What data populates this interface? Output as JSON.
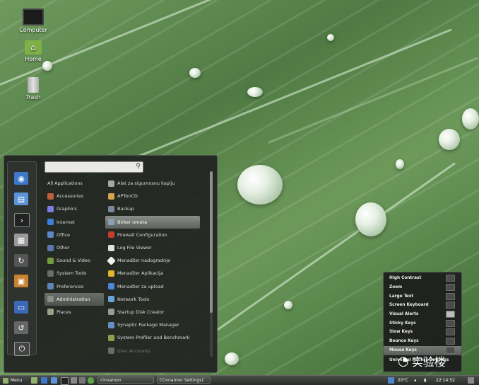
{
  "desktop": {
    "icons": [
      {
        "label": "Computer",
        "icon": "computer-icon"
      },
      {
        "label": "Home",
        "icon": "home-folder-icon"
      },
      {
        "label": "Trash",
        "icon": "trash-icon"
      }
    ]
  },
  "menu": {
    "search": {
      "placeholder": "",
      "value": ""
    },
    "favorites": [
      "browser-icon",
      "document-icon",
      "terminal-icon",
      "settings-icon",
      "software-manager-icon",
      "package-icon",
      "display-icon",
      "logout-icon",
      "power-icon"
    ],
    "categories": [
      {
        "label": "All Applications",
        "color": "#00000000"
      },
      {
        "label": "Accessories",
        "color": "#c25d3b"
      },
      {
        "label": "Graphics",
        "color": "#7c7ee0"
      },
      {
        "label": "Internet",
        "color": "#3c7fd6"
      },
      {
        "label": "Office",
        "color": "#5f86c6"
      },
      {
        "label": "Other",
        "color": "#5b79b0"
      },
      {
        "label": "Sound & Video",
        "color": "#6f9e3a"
      },
      {
        "label": "System Tools",
        "color": "#6c6c6c"
      },
      {
        "label": "Preferences",
        "color": "#5c86b8"
      },
      {
        "label": "Administration",
        "color": "#8a8f8a"
      },
      {
        "label": "Places",
        "color": "#9aa08e"
      }
    ],
    "selected_category": "Administration",
    "apps": [
      {
        "label": "Alat za sigurnosnu kopiju",
        "color": "#a8a8a0"
      },
      {
        "label": "APTonCD",
        "color": "#d3a64a"
      },
      {
        "label": "Backup",
        "color": "#7a8a9a"
      },
      {
        "label": "Birker ometa",
        "color": "#8ea0b4"
      },
      {
        "label": "Firewall Configuration",
        "color": "#c23d2b"
      },
      {
        "label": "Log File Viewer",
        "color": "#e0e0e0"
      },
      {
        "label": "Menadžer nadogradnje",
        "color": "#f2f2f2"
      },
      {
        "label": "Menadžer Aplikacija",
        "color": "#e3b52b"
      },
      {
        "label": "Menadžer za upload",
        "color": "#4c88d8"
      },
      {
        "label": "Network Tools",
        "color": "#6aa2d8"
      },
      {
        "label": "Startup Disk Creator",
        "color": "#9a9a9a"
      },
      {
        "label": "Synaptic Package Manager",
        "color": "#6a8fc6"
      },
      {
        "label": "System Profiler and Benchmark",
        "color": "#8aa050"
      },
      {
        "label": "User Accounts",
        "color": "#6a6a6a"
      }
    ],
    "selected_app": "Birker ometa"
  },
  "a11y": {
    "items": [
      {
        "label": "High Contrast",
        "on": false
      },
      {
        "label": "Zoom",
        "on": false
      },
      {
        "label": "Large Text",
        "on": false
      },
      {
        "label": "Screen Keyboard",
        "on": false
      },
      {
        "label": "Visual Alerts",
        "on": true
      },
      {
        "label": "Sticky Keys",
        "on": false
      },
      {
        "label": "Slow Keys",
        "on": false
      },
      {
        "label": "Bounce Keys",
        "on": false
      },
      {
        "label": "Mouse Keys",
        "on": false
      },
      {
        "label": "Universal Access Settings",
        "on": null
      }
    ],
    "selected": "Mouse Keys"
  },
  "panel": {
    "menu_label": "Menu",
    "tasks": [
      "cinnamon",
      "[Cinnamon Settings]"
    ],
    "temperature": "20°C",
    "clock": "22:14:52"
  },
  "watermark": "实验楼"
}
